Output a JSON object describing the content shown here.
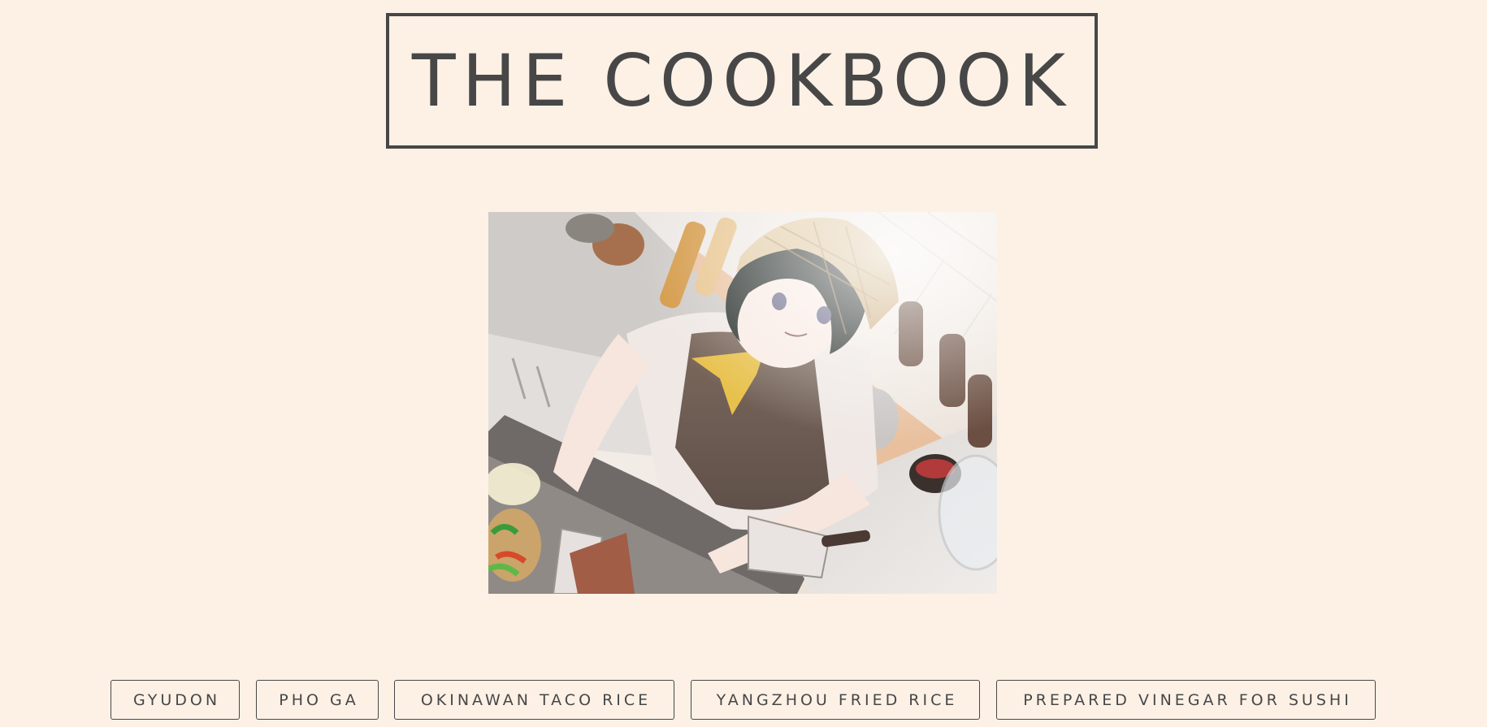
{
  "header": {
    "title": "THE COOKBOOK"
  },
  "hero": {
    "image_alt": "Illustration of a cook in an apron and headscarf grilling at a kitchen counter"
  },
  "recipes": [
    {
      "label": "GYUDON"
    },
    {
      "label": "PHO GA"
    },
    {
      "label": "OKINAWAN TACO RICE"
    },
    {
      "label": "YANGZHOU FRIED RICE"
    },
    {
      "label": "PREPARED VINEGAR FOR SUSHI"
    }
  ],
  "colors": {
    "page_background": "#fdf1e6",
    "text": "#474747",
    "border": "#474747"
  }
}
